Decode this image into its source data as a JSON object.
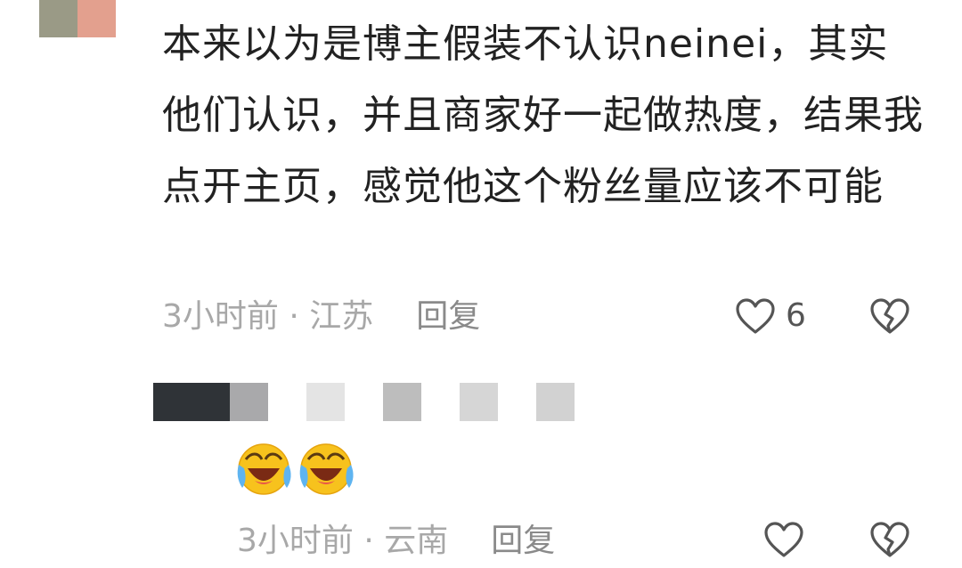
{
  "comment1": {
    "text": "本来以为是博主假装不认识neinei，其实他们认识，并且商家好一起做热度，结果我点开主页，感觉他这个粉丝量应该不可能",
    "time_location": "3小时前 · 江苏",
    "reply_label": "回复",
    "like_count": "6",
    "icons": [
      "heart-outline-icon",
      "broken-heart-icon"
    ]
  },
  "comment2": {
    "emojis": [
      "laughing-crying-emoji",
      "laughing-crying-emoji"
    ],
    "time_location": "3小时前 · 云南",
    "reply_label": "回复",
    "icons": [
      "heart-outline-icon",
      "broken-heart-icon"
    ]
  },
  "colors": {
    "text_primary": "#222222",
    "text_meta": "#a8a8a8",
    "icon_stroke": "#555555"
  }
}
